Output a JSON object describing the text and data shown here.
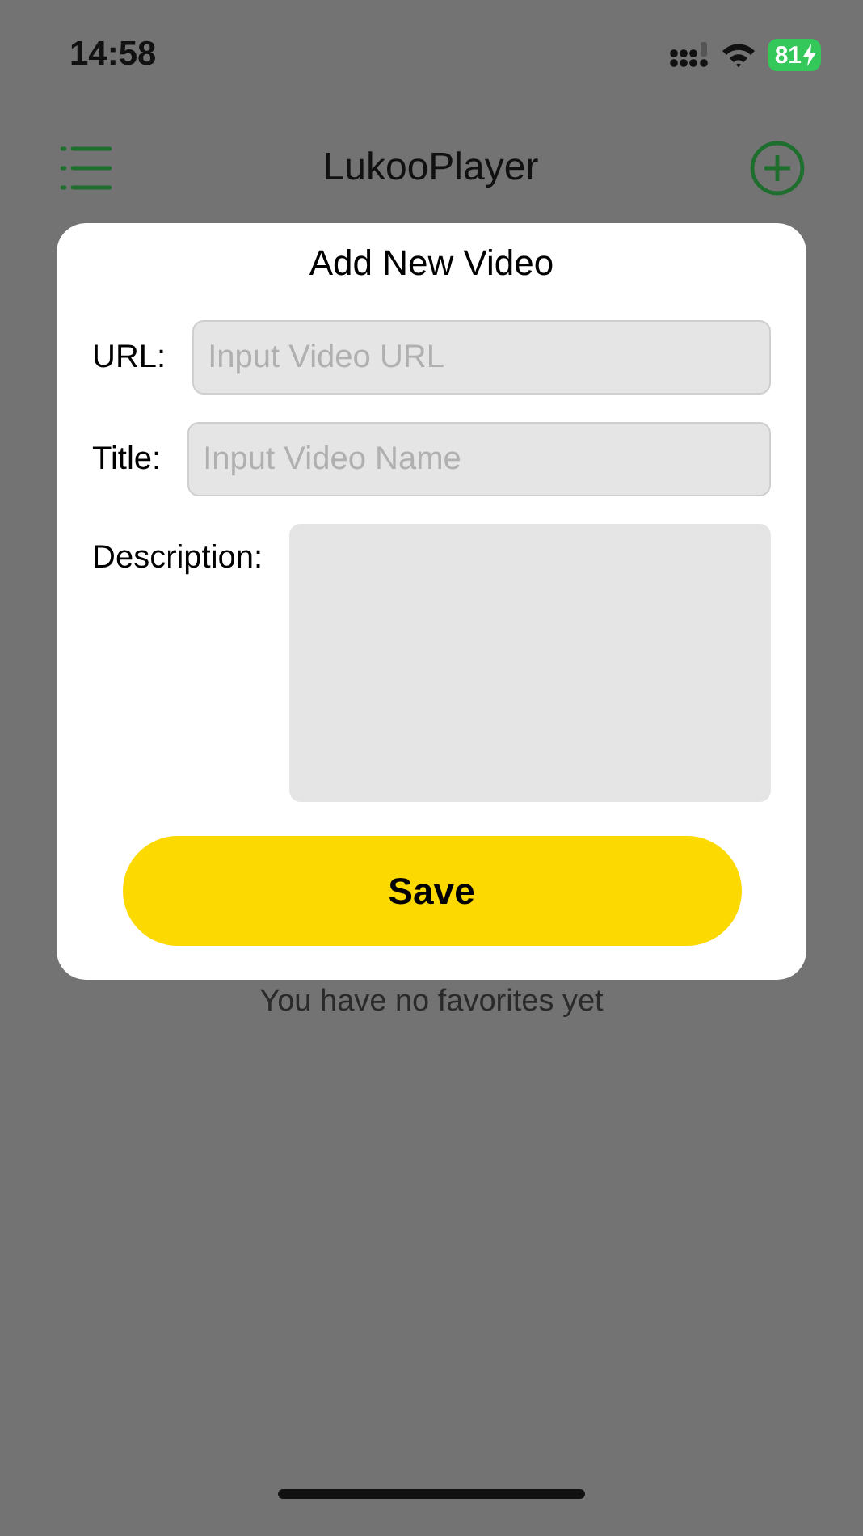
{
  "status_bar": {
    "time": "14:58",
    "battery": "81"
  },
  "nav": {
    "title": "LukooPlayer"
  },
  "empty_message": "You have no favorites yet",
  "dialog": {
    "title": "Add New Video",
    "fields": [
      {
        "kind": "line",
        "label": "URL:",
        "placeholder": "Input Video URL"
      },
      {
        "kind": "line",
        "label": "Title:",
        "placeholder": "Input Video Name"
      },
      {
        "kind": "area",
        "label": "Description:"
      }
    ],
    "save_button": "Save"
  }
}
